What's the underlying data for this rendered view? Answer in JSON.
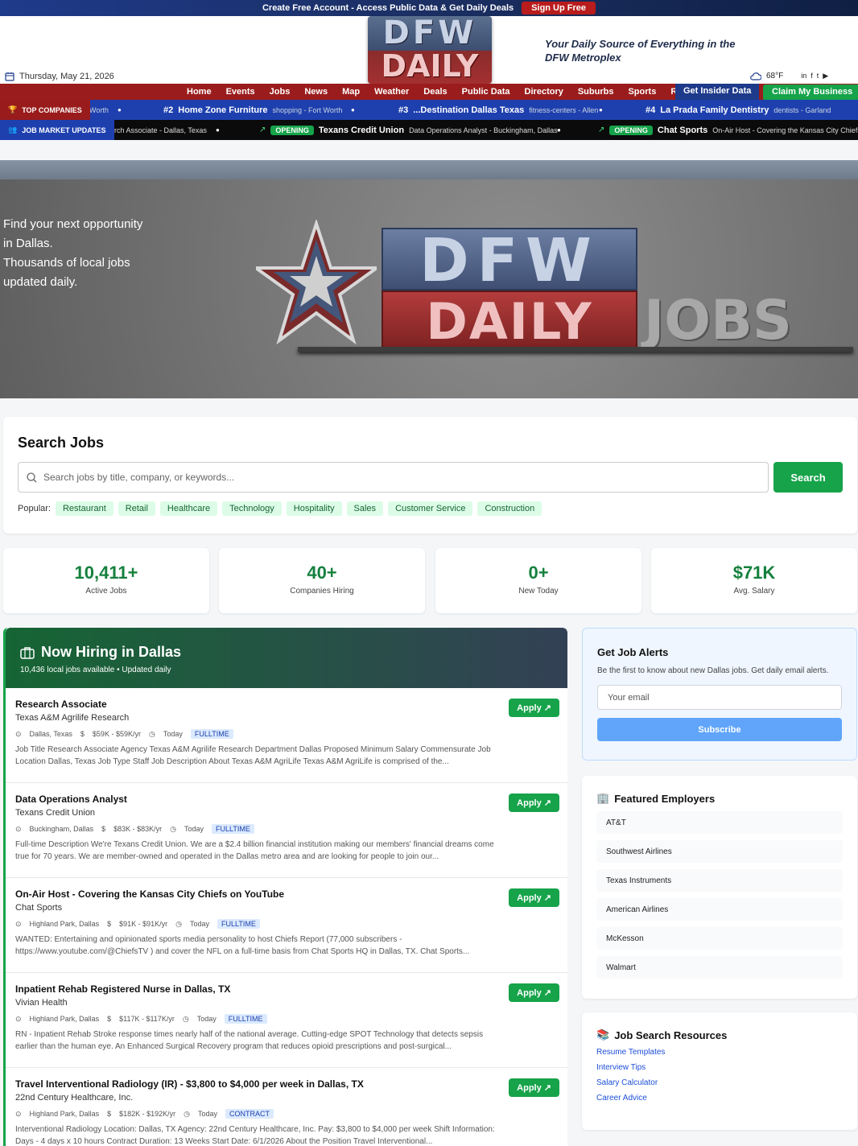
{
  "promo": {
    "text": "Create Free Account - Access Public Data & Get Daily Deals",
    "signup": "Sign Up Free"
  },
  "header": {
    "logo_line1": "DFW",
    "logo_line2": "DAILY",
    "tagline": "Your Daily Source of Everything in the DFW Metroplex",
    "date": "Thursday, May 21, 2026",
    "temperature": "68°F"
  },
  "nav": {
    "items": [
      "Home",
      "Events",
      "Jobs",
      "News",
      "Map",
      "Weather",
      "Deals",
      "Public Data",
      "Directory",
      "Suburbs",
      "Sports",
      "Real Esta"
    ],
    "insider": "Get Insider Data",
    "claim": "Claim My Business"
  },
  "ticker_companies": {
    "label": "TOP COMPANIES",
    "lead": "Worth",
    "items": [
      {
        "rank": "#2",
        "name": "Home Zone Furniture",
        "info": "shopping - Fort Worth"
      },
      {
        "rank": "#3",
        "name": "...Destination Dallas Texas",
        "info": "fitness-centers - Allen"
      },
      {
        "rank": "#4",
        "name": "La Prada Family Dentistry",
        "info": "dentists - Garland"
      }
    ]
  },
  "ticker_jobs": {
    "label": "JOB MARKET UPDATES",
    "lead": "earch Associate - Dallas, Texas",
    "items": [
      {
        "badge": "OPENING",
        "company": "Texans Credit Union",
        "info": "Data Operations Analyst - Buckingham, Dallas"
      },
      {
        "badge": "OPENING",
        "company": "Chat Sports",
        "info": "On-Air Host - Covering the Kansas City Chiefs o"
      }
    ]
  },
  "hero": {
    "lines": [
      "Find your next opportunity",
      "in Dallas.",
      "Thousands of local jobs",
      "updated daily."
    ],
    "logo_line1": "DFW",
    "logo_line2": "DAILY",
    "logo_jobs": "JOBS"
  },
  "search": {
    "title": "Search Jobs",
    "placeholder": "Search jobs by title, company, or keywords...",
    "button": "Search",
    "popular_label": "Popular:",
    "popular": [
      "Restaurant",
      "Retail",
      "Healthcare",
      "Technology",
      "Hospitality",
      "Sales",
      "Customer Service",
      "Construction"
    ]
  },
  "stats": [
    {
      "value": "10,411+",
      "label": "Active Jobs"
    },
    {
      "value": "40+",
      "label": "Companies Hiring"
    },
    {
      "value": "0+",
      "label": "New Today"
    },
    {
      "value": "$71K",
      "label": "Avg. Salary"
    }
  ],
  "hiring": {
    "title": "Now Hiring in Dallas",
    "subtitle": "10,436 local jobs available • Updated daily",
    "apply_label": "Apply",
    "jobs": [
      {
        "title": "Research Associate",
        "company": "Texas A&M Agrilife Research",
        "location": "Dallas, Texas",
        "salary": "$59K - $59K/yr",
        "posted": "Today",
        "type": "FULLTIME",
        "desc": "Job Title Research Associate Agency Texas A&M Agrilife Research Department Dallas Proposed Minimum Salary Commensurate Job Location Dallas, Texas Job Type Staff Job Description About Texas A&M AgriLife Texas A&M AgriLife is comprised of the..."
      },
      {
        "title": "Data Operations Analyst",
        "company": "Texans Credit Union",
        "location": "Buckingham, Dallas",
        "salary": "$83K - $83K/yr",
        "posted": "Today",
        "type": "FULLTIME",
        "desc": "Full-time Description We're Texans Credit Union. We are a $2.4 billion financial institution making our members' financial dreams come true for 70 years. We are member-owned and operated in the Dallas metro area and are looking for people to join our..."
      },
      {
        "title": "On-Air Host - Covering the Kansas City Chiefs on YouTube",
        "company": "Chat Sports",
        "location": "Highland Park, Dallas",
        "salary": "$91K - $91K/yr",
        "posted": "Today",
        "type": "FULLTIME",
        "desc": "WANTED: Entertaining and opinionated sports media personality to host Chiefs Report (77,000 subscribers - https://www.youtube.com/@ChiefsTV ) and cover the NFL on a full-time basis from Chat Sports HQ in Dallas, TX. Chat Sports..."
      },
      {
        "title": "Inpatient Rehab Registered Nurse in Dallas, TX",
        "company": "Vivian Health",
        "location": "Highland Park, Dallas",
        "salary": "$117K - $117K/yr",
        "posted": "Today",
        "type": "FULLTIME",
        "desc": "RN - Inpatient Rehab Stroke response times nearly half of the national average. Cutting-edge SPOT Technology that detects sepsis earlier than the human eye. An Enhanced Surgical Recovery program that reduces opioid prescriptions and post-surgical..."
      },
      {
        "title": "Travel Interventional Radiology (IR) - $3,800 to $4,000 per week in Dallas, TX",
        "company": "22nd Century Healthcare, Inc.",
        "location": "Highland Park, Dallas",
        "salary": "$182K - $192K/yr",
        "posted": "Today",
        "type": "CONTRACT",
        "desc": "Interventional Radiology Location: Dallas, TX Agency: 22nd Century Healthcare, Inc. Pay: $3,800 to $4,000 per week Shift Information: Days - 4 days x 10 hours Contract Duration: 13 Weeks Start Date: 6/1/2026 About the Position Travel Interventional..."
      }
    ]
  },
  "alerts": {
    "title": "Get Job Alerts",
    "text": "Be the first to know about new Dallas jobs. Get daily email alerts.",
    "placeholder": "Your email",
    "button": "Subscribe"
  },
  "employers": {
    "title": "Featured Employers",
    "items": [
      "AT&T",
      "Southwest Airlines",
      "Texas Instruments",
      "American Airlines",
      "McKesson",
      "Walmart"
    ]
  },
  "resources": {
    "title": "Job Search Resources",
    "links": [
      "Resume Templates",
      "Interview Tips",
      "Salary Calculator",
      "Career Advice"
    ]
  }
}
